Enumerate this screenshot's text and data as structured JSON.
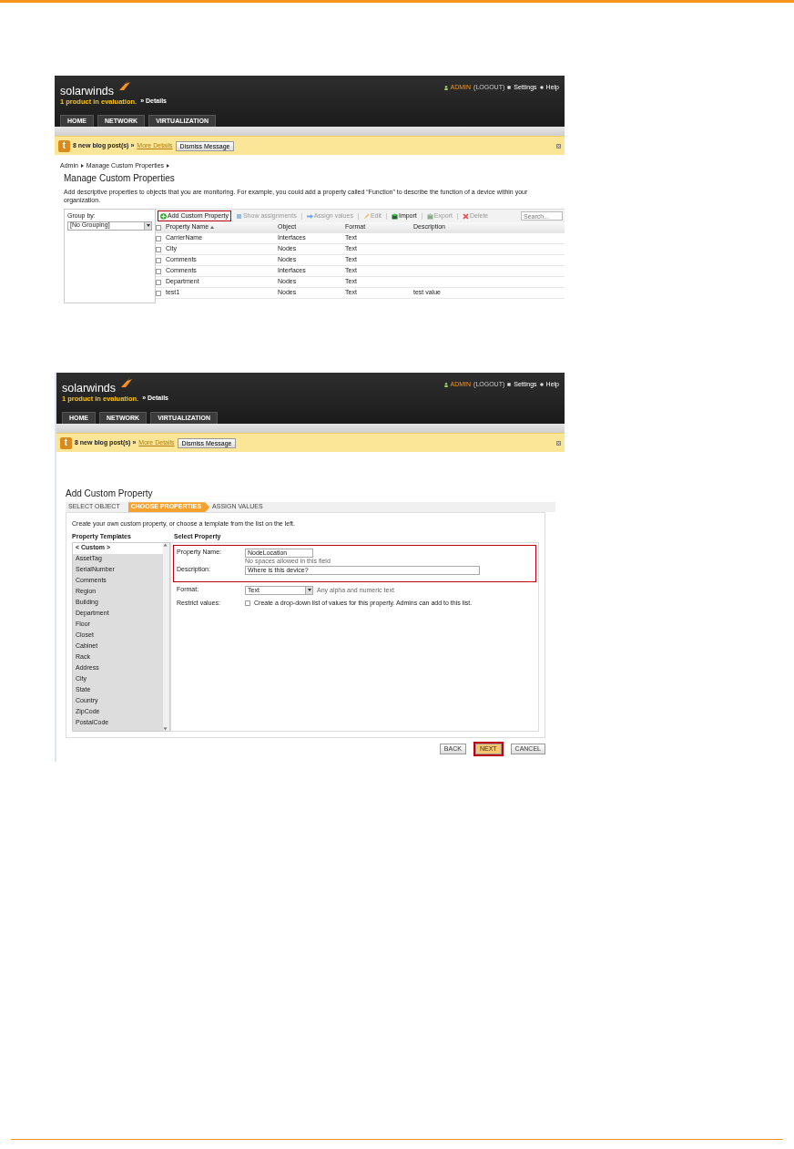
{
  "screenshots": [
    {
      "kind": "list",
      "header": {
        "logo": "solarwinds",
        "evaluation": "1 product in evaluation.",
        "details": "» Details",
        "user": "ADMIN",
        "logout": "(LOGOUT)",
        "settings": "Settings",
        "help": "Help",
        "tabs": [
          "HOME",
          "NETWORK",
          "VIRTUALIZATION"
        ]
      },
      "banner": {
        "icon": "t",
        "text": "8 new blog post(s) »",
        "link": "More Details",
        "button": "Dismiss Message"
      },
      "breadcrumb": [
        "Admin",
        "Manage Custom Properties"
      ],
      "title": "Manage Custom Properties",
      "description": "Add descriptive properties to objects that you are monitoring. For example, you could add a property called “Function” to describe the function of a device within your organization.",
      "group_by": {
        "label": "Group by:",
        "value": "[No Grouping]"
      },
      "toolbar": [
        {
          "label": "Add Custom Property",
          "disabled": false,
          "highlighted": true
        },
        {
          "label": "Show assignments",
          "disabled": true,
          "highlighted": false
        },
        {
          "label": "Assign values",
          "disabled": true,
          "highlighted": false
        },
        {
          "label": "Edit",
          "disabled": true,
          "highlighted": false
        },
        {
          "label": "Import",
          "disabled": false,
          "highlighted": false
        },
        {
          "label": "Export",
          "disabled": true,
          "highlighted": false
        },
        {
          "label": "Delete",
          "disabled": true,
          "highlighted": false
        }
      ],
      "select_all_checked": false,
      "search": {
        "placeholder": "Search..."
      },
      "columns": [
        "Property Name",
        "Object",
        "Format",
        "Description"
      ],
      "rows": [
        {
          "cells": [
            "CarrierName",
            "Interfaces",
            "Text",
            ""
          ],
          "checked": false
        },
        {
          "cells": [
            "City",
            "Nodes",
            "Text",
            ""
          ],
          "checked": false
        },
        {
          "cells": [
            "Comments",
            "Nodes",
            "Text",
            ""
          ],
          "checked": false
        },
        {
          "cells": [
            "Comments",
            "Interfaces",
            "Text",
            ""
          ],
          "checked": false
        },
        {
          "cells": [
            "Department",
            "Nodes",
            "Text",
            ""
          ],
          "checked": false
        },
        {
          "cells": [
            "test1",
            "Nodes",
            "Text",
            "test value"
          ],
          "checked": false
        }
      ]
    },
    {
      "kind": "wizard",
      "header": {
        "logo": "solarwinds",
        "evaluation": "1 product in evaluation.",
        "details": "» Details",
        "user": "ADMIN",
        "logout": "(LOGOUT)",
        "settings": "Settings",
        "help": "Help",
        "tabs": [
          "HOME",
          "NETWORK",
          "VIRTUALIZATION"
        ]
      },
      "banner": {
        "icon": "t",
        "text": "8 new blog post(s) »",
        "link": "More Details",
        "button": "Dismiss Message"
      },
      "title": "Add Custom Property",
      "steps": [
        {
          "label": "SELECT OBJECT",
          "selected": false
        },
        {
          "label": "CHOOSE PROPERTIES",
          "selected": true
        },
        {
          "label": "ASSIGN VALUES",
          "selected": false
        }
      ],
      "intro": "Create your own custom property, or choose a template from the list on the left.",
      "templates": {
        "heading": "Property Templates",
        "items": [
          {
            "label": "< Custom >",
            "selected": true
          },
          {
            "label": "AssetTag",
            "selected": false
          },
          {
            "label": "SerialNumber",
            "selected": false
          },
          {
            "label": "Comments",
            "selected": false
          },
          {
            "label": "Region",
            "selected": false
          },
          {
            "label": "Building",
            "selected": false
          },
          {
            "label": "Department",
            "selected": false
          },
          {
            "label": "Floor",
            "selected": false
          },
          {
            "label": "Closet",
            "selected": false
          },
          {
            "label": "Cabinet",
            "selected": false
          },
          {
            "label": "Rack",
            "selected": false
          },
          {
            "label": "Address",
            "selected": false
          },
          {
            "label": "City",
            "selected": false
          },
          {
            "label": "State",
            "selected": false
          },
          {
            "label": "Country",
            "selected": false
          },
          {
            "label": "ZipCode",
            "selected": false
          },
          {
            "label": "PostalCode",
            "selected": false
          }
        ]
      },
      "form_heading": "Select Property",
      "field_groups": [
        {
          "highlighted": true,
          "fields": [
            {
              "kind": "text",
              "label": "Property Name:",
              "value": "NodeLocation",
              "hint": "No spaces allowed in this field"
            },
            {
              "kind": "wide",
              "label": "Description:",
              "value": "Where is this device?"
            }
          ]
        },
        {
          "highlighted": false,
          "fields": [
            {
              "kind": "select",
              "label": "Format:",
              "value": "Text",
              "hint": "Any alpha and numeric text"
            },
            {
              "kind": "checkbox",
              "label": "Restrict values:",
              "text": "Create a drop-down list of values for this property. Admins can add to this list.",
              "checked": false
            }
          ]
        }
      ],
      "buttons": [
        {
          "label": "BACK",
          "highlighted": false
        },
        {
          "label": "NEXT",
          "highlighted": true
        },
        {
          "label": "CANCEL",
          "highlighted": false
        }
      ]
    }
  ]
}
